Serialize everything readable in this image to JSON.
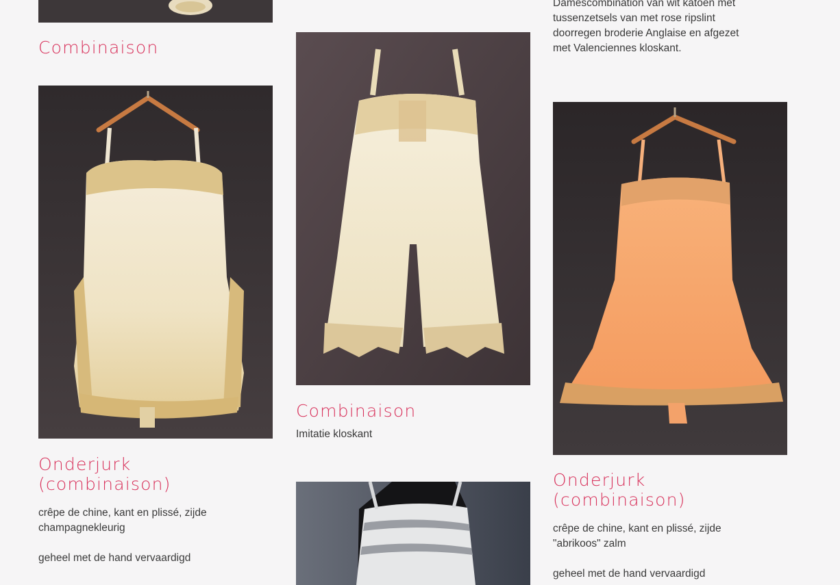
{
  "colors": {
    "title": "#d8305a",
    "text": "#3a3a3a",
    "background": "#f6f5f6"
  },
  "column1": {
    "item1": {
      "title": "Combinaison",
      "image": "garment-photo-top-cropped"
    },
    "item2": {
      "title_line1": "Onderjurk",
      "title_line2": "(combinaison)",
      "desc_line1": "crêpe de chine, kant en plissé, zijde",
      "desc_line2": "champagnekleurig",
      "desc_line3": "geheel met de hand vervaardigd",
      "image": "cream-slip-dress-on-hanger"
    }
  },
  "column2": {
    "item1": {
      "title": "Combinaison",
      "desc": "Imitatie kloskant",
      "image": "cream-combinaison-with-lace"
    },
    "item2": {
      "image": "white-corset-on-mannequin"
    }
  },
  "column3": {
    "item0": {
      "desc_line1": "Damescombination van wit katoen met",
      "desc_line2": "tussenzetsels van met rose ripslint",
      "desc_line3": "doorregen broderie Anglaise en afgezet",
      "desc_line4": "met Valenciennes kloskant."
    },
    "item1": {
      "title_line1": "Onderjurk",
      "title_line2": "(combinaison)",
      "desc_line1": "crêpe de chine, kant en plissé, zijde",
      "desc_line2": "\"abrikoos\" zalm",
      "desc_line3": "geheel met de hand vervaardigd",
      "image": "apricot-slip-dress-on-hanger"
    }
  }
}
